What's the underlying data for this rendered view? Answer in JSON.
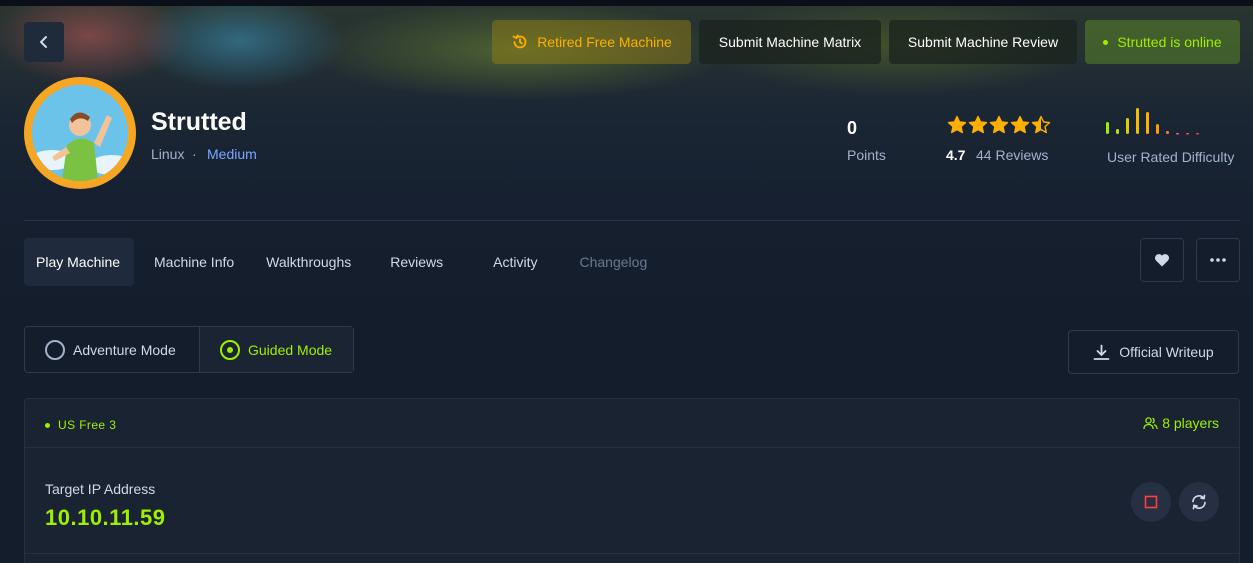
{
  "header": {
    "retired_label": "Retired Free Machine",
    "matrix_label": "Submit Machine Matrix",
    "review_label": "Submit Machine Review",
    "online_label": "Strutted is online"
  },
  "machine": {
    "name": "Strutted",
    "os": "Linux",
    "separator": "·",
    "difficulty": "Medium",
    "points": "0",
    "points_label": "Points",
    "rating": "4.7",
    "reviews": "44 Reviews",
    "stars": 4.5,
    "difficulty_label": "User Rated Difficulty"
  },
  "tabs": [
    {
      "label": "Play Machine"
    },
    {
      "label": "Machine Info"
    },
    {
      "label": "Walkthroughs"
    },
    {
      "label": "Reviews"
    },
    {
      "label": "Activity"
    },
    {
      "label": "Changelog"
    }
  ],
  "modes": {
    "adventure": "Adventure Mode",
    "guided": "Guided Mode",
    "selected": "guided"
  },
  "writeup_label": "Official Writeup",
  "server": {
    "name": "US Free 3",
    "players": "8 players"
  },
  "target": {
    "label": "Target IP Address",
    "ip": "10.10.11.59"
  },
  "colors": {
    "accent": "#9fef00",
    "warning": "#ffaf00",
    "background": "#141d2b"
  },
  "icons": [
    "chevron-left-icon",
    "history-icon",
    "star-icon",
    "heart-icon",
    "more-icon",
    "download-icon",
    "users-icon",
    "stop-icon",
    "refresh-icon"
  ]
}
